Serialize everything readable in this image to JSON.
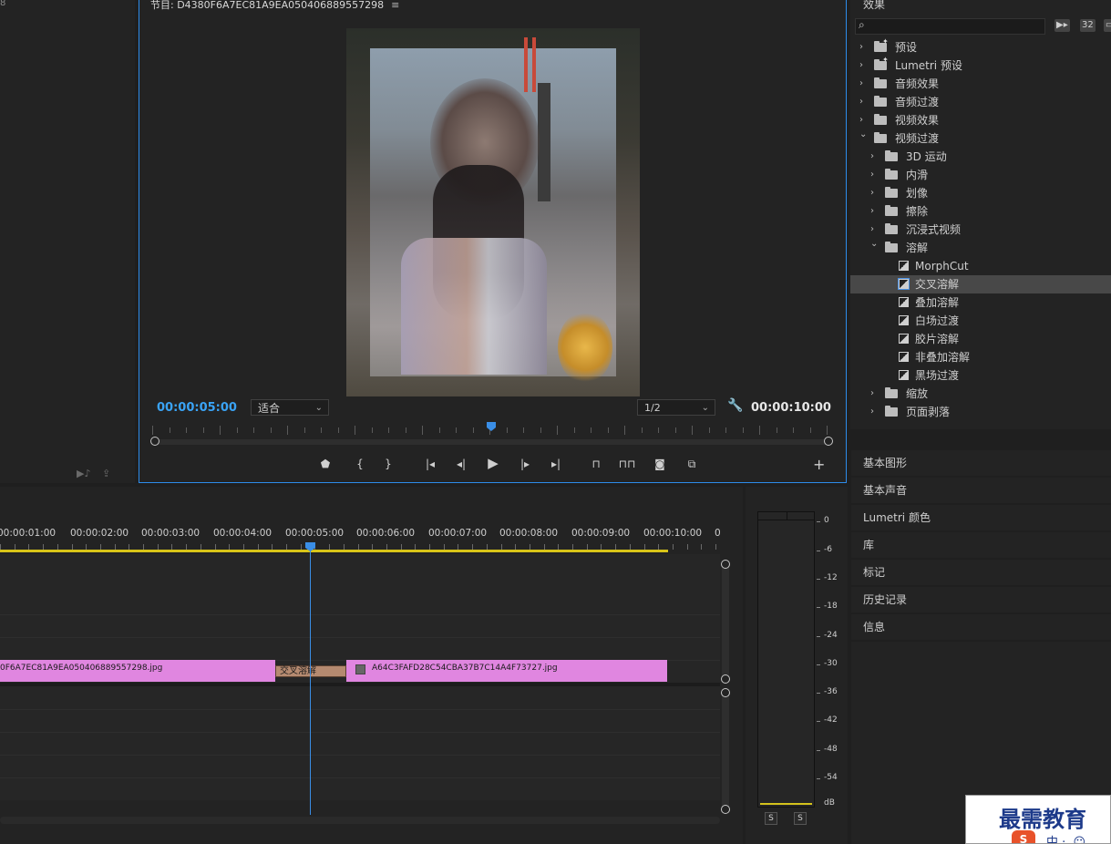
{
  "left_panel": {
    "top_fragment": "8"
  },
  "program_monitor": {
    "title": "节目: D4380F6A7EC81A9EA050406889557298",
    "menu_icon": "≡",
    "timecode_current": "00:00:05:00",
    "zoom_value": "适合",
    "resolution_value": "1/2",
    "timecode_duration": "00:00:10:00",
    "playhead_fraction": 0.5,
    "icons": {
      "wrench": "wrench-icon",
      "marker": "marker-icon",
      "mark_in": "mark-in-icon",
      "mark_out": "mark-out-icon",
      "go_to_in": "go-to-in-icon",
      "step_back": "step-back-icon",
      "play": "play-icon",
      "step_forward": "step-forward-icon",
      "go_to_out": "go-to-out-icon",
      "lift": "lift-icon",
      "extract": "extract-icon",
      "export_frame": "camera-icon",
      "comparison": "comparison-view-icon",
      "add": "add-icon"
    }
  },
  "effects": {
    "title": "效果",
    "tool_labels": [
      "32"
    ],
    "items": [
      {
        "label": "预设",
        "depth": 0,
        "expanded": false,
        "type": "folder-star"
      },
      {
        "label": "Lumetri 预设",
        "depth": 0,
        "expanded": false,
        "type": "folder-star"
      },
      {
        "label": "音频效果",
        "depth": 0,
        "expanded": false,
        "type": "folder"
      },
      {
        "label": "音频过渡",
        "depth": 0,
        "expanded": false,
        "type": "folder"
      },
      {
        "label": "视频效果",
        "depth": 0,
        "expanded": false,
        "type": "folder"
      },
      {
        "label": "视频过渡",
        "depth": 0,
        "expanded": true,
        "type": "folder"
      },
      {
        "label": "3D 运动",
        "depth": 1,
        "expanded": false,
        "type": "folder"
      },
      {
        "label": "内滑",
        "depth": 1,
        "expanded": false,
        "type": "folder"
      },
      {
        "label": "划像",
        "depth": 1,
        "expanded": false,
        "type": "folder"
      },
      {
        "label": "擦除",
        "depth": 1,
        "expanded": false,
        "type": "folder"
      },
      {
        "label": "沉浸式视频",
        "depth": 1,
        "expanded": false,
        "type": "folder"
      },
      {
        "label": "溶解",
        "depth": 1,
        "expanded": true,
        "type": "folder"
      },
      {
        "label": "MorphCut",
        "depth": 2,
        "type": "transition"
      },
      {
        "label": "交叉溶解",
        "depth": 2,
        "type": "transition",
        "selected": true
      },
      {
        "label": "叠加溶解",
        "depth": 2,
        "type": "transition"
      },
      {
        "label": "白场过渡",
        "depth": 2,
        "type": "transition"
      },
      {
        "label": "胶片溶解",
        "depth": 2,
        "type": "transition"
      },
      {
        "label": "非叠加溶解",
        "depth": 2,
        "type": "transition"
      },
      {
        "label": "黑场过渡",
        "depth": 2,
        "type": "transition"
      },
      {
        "label": "缩放",
        "depth": 1,
        "expanded": false,
        "type": "folder"
      },
      {
        "label": "页面剥落",
        "depth": 1,
        "expanded": false,
        "type": "folder"
      }
    ]
  },
  "panels": [
    "基本图形",
    "基本声音",
    "Lumetri 颜色",
    "库",
    "标记",
    "历史记录",
    "信息"
  ],
  "timeline": {
    "time_labels": [
      "00:00:01:00",
      "00:00:02:00",
      "00:00:03:00",
      "00:00:04:00",
      "00:00:05:00",
      "00:00:06:00",
      "00:00:07:00",
      "00:00:08:00",
      "00:00:09:00",
      "00:00:10:00",
      "0"
    ],
    "clip_a_name": "0F6A7EC81A9EA050406889557298.jpg",
    "clip_b_name": "A64C3FAFD28C54CBA37B7C14A4F73727.jpg",
    "transition_name": "交叉溶解"
  },
  "audio_meter": {
    "db_labels": [
      "0",
      "-6",
      "-12",
      "-18",
      "-24",
      "-30",
      "-36",
      "-42",
      "-48",
      "-54",
      "dB"
    ],
    "solo_labels": [
      "S",
      "S"
    ]
  },
  "watermark": {
    "text": "最需教育",
    "logo": "S",
    "ime": "中 ·, ☺"
  }
}
